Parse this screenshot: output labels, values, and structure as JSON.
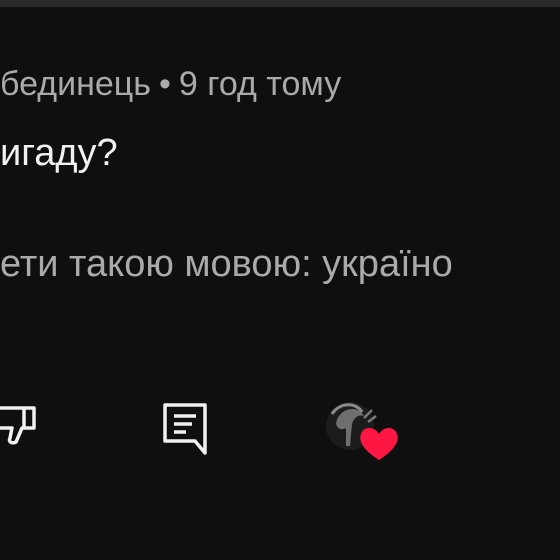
{
  "comment": {
    "author": "бединець",
    "separator": "•",
    "timestamp": "9 год тому",
    "text": "игаду?",
    "translate_prompt": "ети такою мовою: україно"
  },
  "actions": {
    "dislike_icon": "thumb-down-icon",
    "reply_icon": "reply-comment-icon",
    "hearted_icon": "creator-heart-icon"
  },
  "colors": {
    "background": "#0f0f0f",
    "primary_text": "#f1f1f1",
    "secondary_text": "#aaaaaa",
    "heart": "#ff1744"
  }
}
